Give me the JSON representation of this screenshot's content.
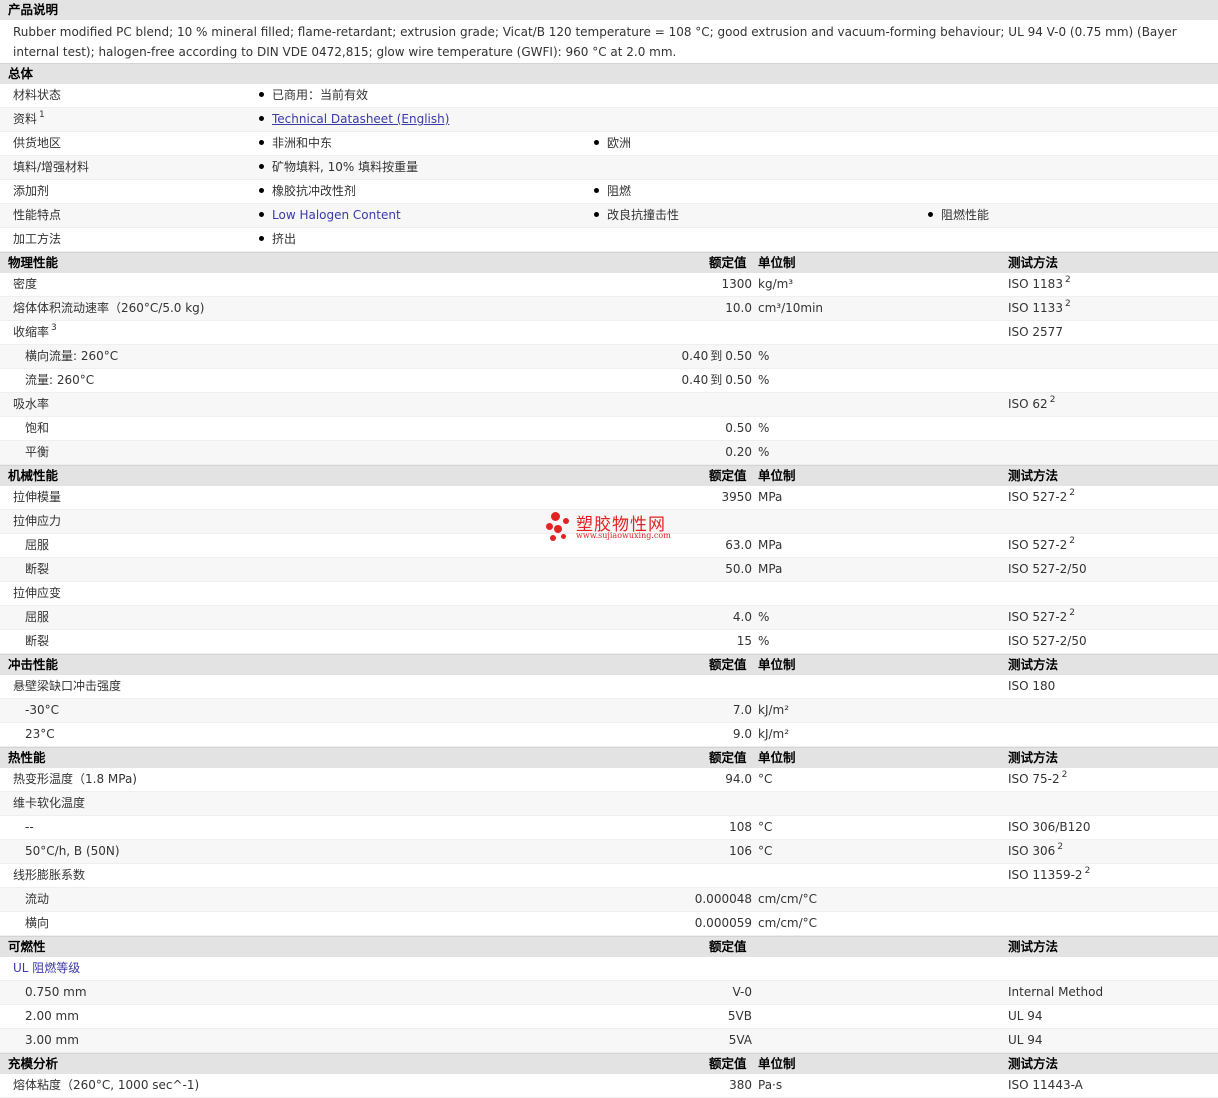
{
  "desc": {
    "title": "产品说明",
    "text": "Rubber modified PC blend; 10 % mineral filled; flame-retardant; extrusion grade; Vicat/B 120 temperature = 108 °C; good extrusion and vacuum-forming behaviour; UL 94 V-0 (0.75 mm) (Bayer internal test); halogen-free according to DIN VDE 0472,815; glow wire temperature (GWFI): 960 °C at 2.0 mm."
  },
  "general": {
    "title": "总体",
    "rows": [
      {
        "label": "材料状态",
        "items": [
          "已商用：当前有效"
        ]
      },
      {
        "label": "资料",
        "sup": "1",
        "items": [
          "Technical Datasheet (English)"
        ]
      },
      {
        "label": "供货地区",
        "items": [
          "非洲和中东",
          "欧洲"
        ]
      },
      {
        "label": "填料/增强材料",
        "items": [
          "矿物填料, 10% 填料按重量"
        ]
      },
      {
        "label": "添加剂",
        "items": [
          "橡胶抗冲改性剂",
          "阻燃"
        ]
      },
      {
        "label": "性能特点",
        "items": [
          "Low Halogen Content",
          "改良抗撞击性",
          "阻燃性能"
        ]
      },
      {
        "label": "加工方法",
        "items": [
          "挤出"
        ]
      }
    ]
  },
  "headers": {
    "value": "额定值",
    "unit": "单位制",
    "method": "测试方法"
  },
  "physical": {
    "title": "物理性能",
    "rows": [
      {
        "label": "密度",
        "value": "1300",
        "unit": "kg/m³",
        "method": "ISO 1183",
        "msup": "2"
      },
      {
        "label": "熔体体积流动速率（260°C/5.0 kg)",
        "value": "10.0",
        "unit": "cm³/10min",
        "method": "ISO 1133",
        "msup": "2"
      },
      {
        "label": "收缩率",
        "sup": "3",
        "method": "ISO 2577"
      },
      {
        "label": "横向流量: 260°C",
        "sub": true,
        "vfrom": "0.40",
        "to": "到",
        "vto": "0.50",
        "unit": "%"
      },
      {
        "label": "流量: 260°C",
        "sub": true,
        "vfrom": "0.40",
        "to": "到",
        "vto": "0.50",
        "unit": "%"
      },
      {
        "label": "吸水率",
        "method": "ISO 62",
        "msup": "2"
      },
      {
        "label": "饱和",
        "sub": true,
        "value": "0.50",
        "unit": "%"
      },
      {
        "label": "平衡",
        "sub": true,
        "value": "0.20",
        "unit": "%"
      }
    ]
  },
  "mechanical": {
    "title": "机械性能",
    "rows": [
      {
        "label": "拉伸模量",
        "value": "3950",
        "unit": "MPa",
        "method": "ISO 527-2",
        "msup": "2"
      },
      {
        "label": "拉伸应力"
      },
      {
        "label": "屈服",
        "sub": true,
        "value": "63.0",
        "unit": "MPa",
        "method": "ISO 527-2",
        "msup": "2"
      },
      {
        "label": "断裂",
        "sub": true,
        "value": "50.0",
        "unit": "MPa",
        "method": "ISO 527-2/50"
      },
      {
        "label": "拉伸应变"
      },
      {
        "label": "屈服",
        "sub": true,
        "value": "4.0",
        "unit": "%",
        "method": "ISO 527-2",
        "msup": "2"
      },
      {
        "label": "断裂",
        "sub": true,
        "value": "15",
        "unit": "%",
        "method": "ISO 527-2/50"
      }
    ]
  },
  "impact": {
    "title": "冲击性能",
    "rows": [
      {
        "label": "悬壁梁缺口冲击强度",
        "method": "ISO 180"
      },
      {
        "label": "-30°C",
        "sub": true,
        "value": "7.0",
        "unit": "kJ/m²"
      },
      {
        "label": "23°C",
        "sub": true,
        "value": "9.0",
        "unit": "kJ/m²"
      }
    ]
  },
  "thermal": {
    "title": "热性能",
    "rows": [
      {
        "label": "热变形温度（1.8 MPa)",
        "value": "94.0",
        "unit": "°C",
        "method": "ISO 75-2",
        "msup": "2"
      },
      {
        "label": "维卡软化温度"
      },
      {
        "label": "--",
        "sub": true,
        "value": "108",
        "unit": "°C",
        "method": "ISO 306/B120"
      },
      {
        "label": "50°C/h, B (50N)",
        "sub": true,
        "value": "106",
        "unit": "°C",
        "method": "ISO 306",
        "msup": "2"
      },
      {
        "label": "线形膨胀系数",
        "method": "ISO 11359-2",
        "msup": "2"
      },
      {
        "label": "流动",
        "sub": true,
        "value": "0.000048",
        "unit": "cm/cm/°C"
      },
      {
        "label": "横向",
        "sub": true,
        "value": "0.000059",
        "unit": "cm/cm/°C"
      }
    ]
  },
  "flammability": {
    "title": "可燃性",
    "rows": [
      {
        "label": "UL 阻燃等级",
        "blue": true
      },
      {
        "label": "0.750 mm",
        "sub": true,
        "value": "V-0",
        "method": "Internal Method"
      },
      {
        "label": "2.00 mm",
        "sub": true,
        "value": "5VB",
        "method": "UL 94"
      },
      {
        "label": "3.00 mm",
        "sub": true,
        "value": "5VA",
        "method": "UL 94"
      }
    ]
  },
  "mold": {
    "title": "充模分析",
    "rows": [
      {
        "label": "熔体粘度（260°C, 1000 sec^-1)",
        "value": "380",
        "unit": "Pa·s",
        "method": "ISO 11443-A"
      }
    ]
  },
  "watermark": {
    "title": "塑胶物性网",
    "url": "www.sujiaowuxing.com",
    "color": "#e32222"
  }
}
